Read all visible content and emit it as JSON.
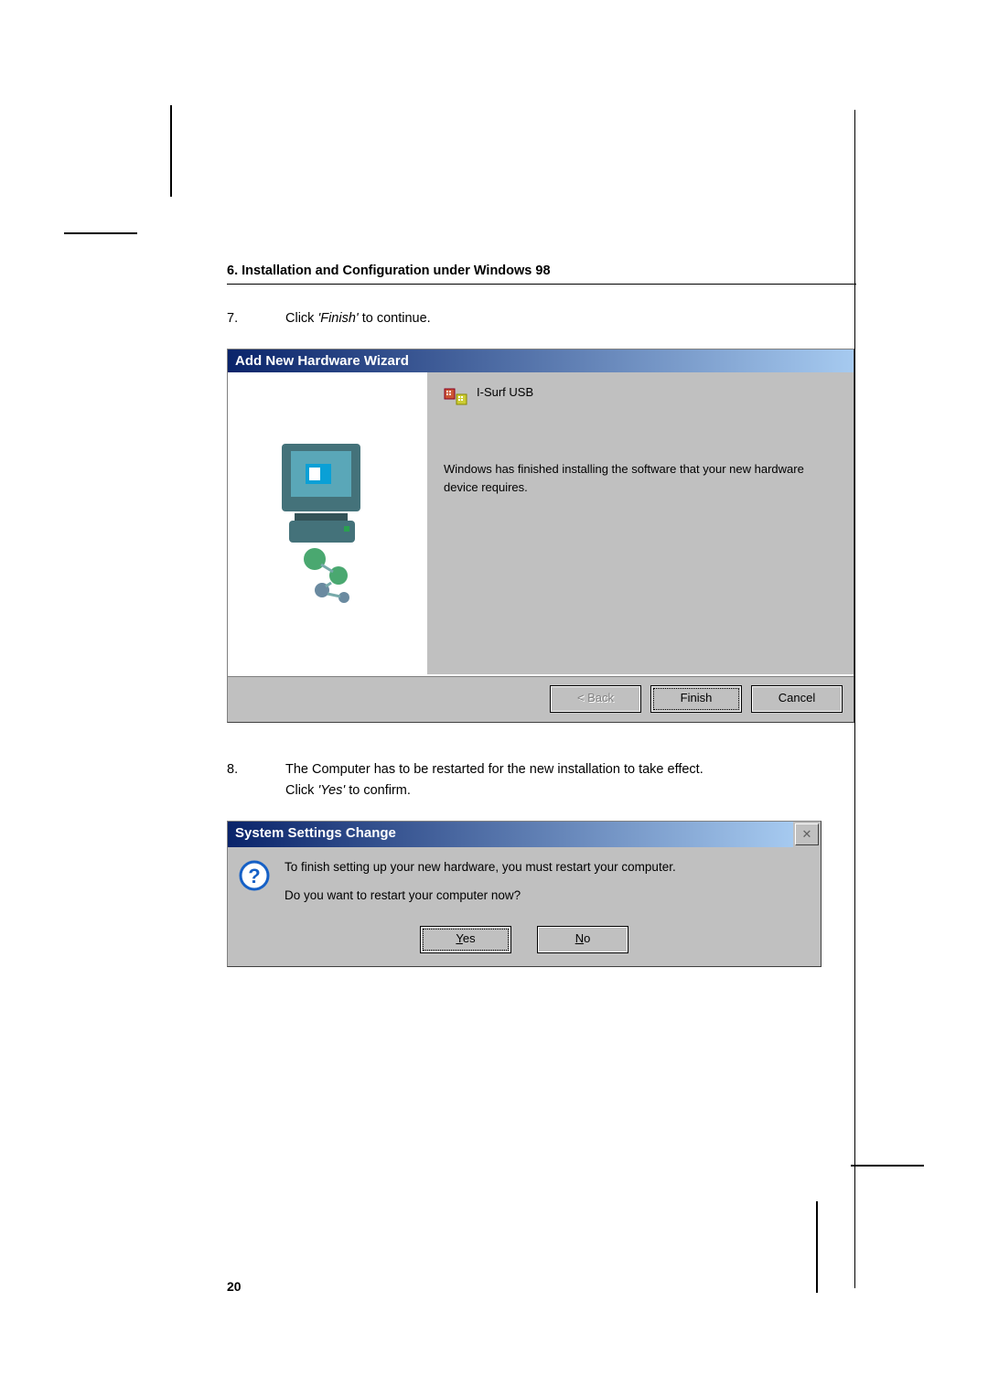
{
  "section_heading": "6. Installation and Configuration under Windows 98",
  "page_number": "20",
  "steps": {
    "s7": {
      "num": "7.",
      "pre": "Click ",
      "em": "'Finish'",
      "post": " to continue."
    },
    "s8": {
      "num": "8.",
      "line1a": "The Computer has to be restarted for the new installation to take effect.",
      "line2_pre": "Click ",
      "line2_em": "'Yes'",
      "line2_post": " to confirm."
    }
  },
  "wizard": {
    "title": "Add New Hardware Wizard",
    "device_name": "I-Surf USB",
    "message": "Windows has finished installing the software that your new hardware device requires.",
    "buttons": {
      "back": "< Back",
      "finish": "Finish",
      "cancel": "Cancel"
    }
  },
  "ssc": {
    "title": "System Settings Change",
    "line1": "To finish setting up your new hardware, you must restart your computer.",
    "line2": "Do you want to restart your computer now?",
    "yes_u": "Y",
    "yes_rest": "es",
    "no_u": "N",
    "no_rest": "o",
    "close": "✕"
  }
}
